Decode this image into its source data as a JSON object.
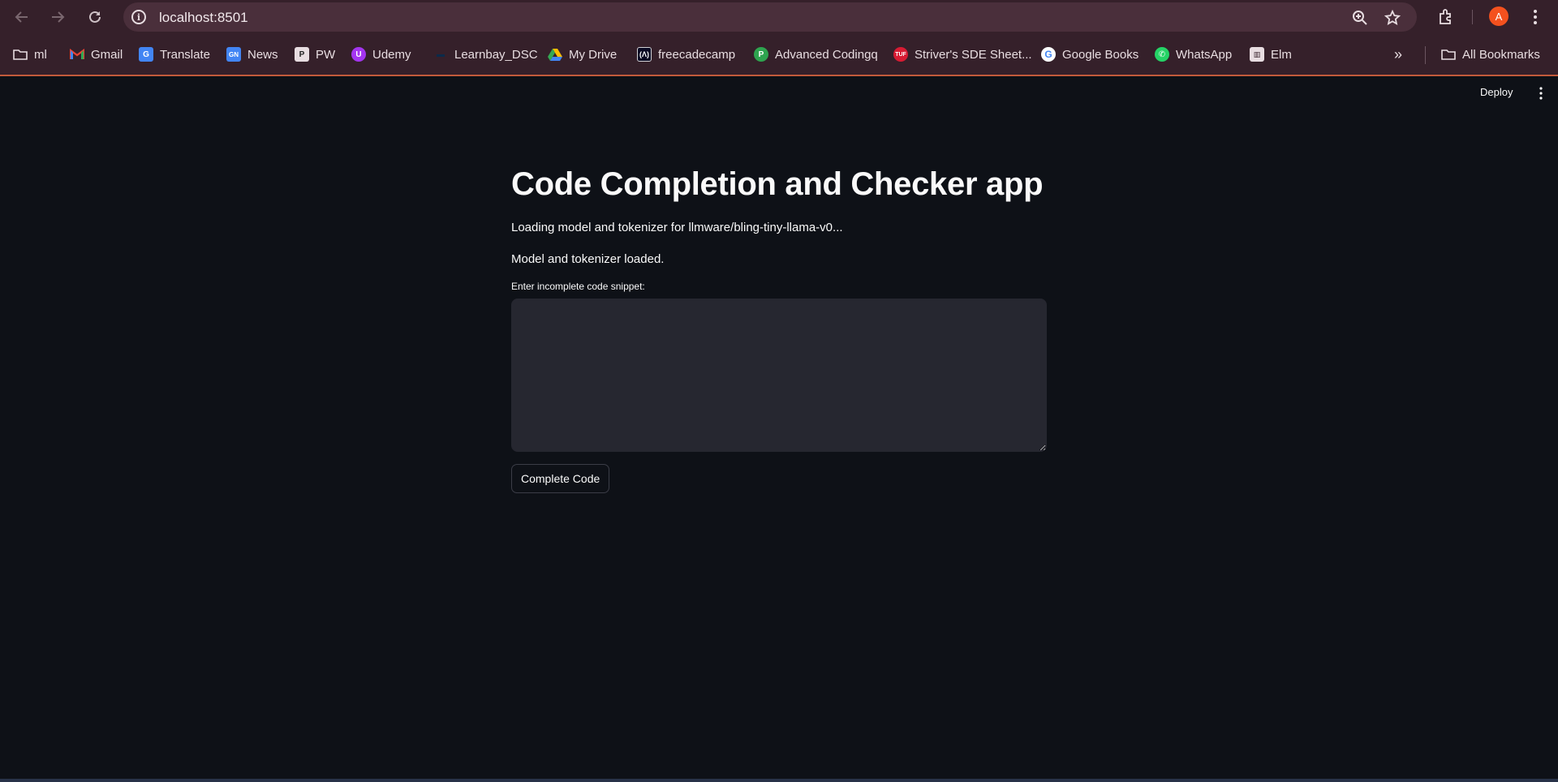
{
  "browser": {
    "url": "localhost:8501",
    "profile_initial": "A",
    "all_bookmarks_label": "All Bookmarks",
    "bookmarks": [
      {
        "label": "ml",
        "icon": "folder-icon",
        "color": "#e8dde1"
      },
      {
        "label": "Gmail",
        "icon": "gmail-icon",
        "color": "#ea4335"
      },
      {
        "label": "Translate",
        "icon": "translate-icon",
        "color": "#4285f4"
      },
      {
        "label": "News",
        "icon": "news-icon",
        "color": "#4285f4"
      },
      {
        "label": "PW",
        "icon": "pw-icon",
        "color": "#e8dde1"
      },
      {
        "label": "Udemy",
        "icon": "udemy-icon",
        "color": "#a435f0"
      },
      {
        "label": "Learnbay_DSC",
        "icon": "learnbay-icon",
        "color": "#0b2a4a"
      },
      {
        "label": "My Drive",
        "icon": "drive-icon",
        "color": "#34a853"
      },
      {
        "label": "freecadecamp",
        "icon": "freecodecamp-icon",
        "color": "#0a0a23"
      },
      {
        "label": "Advanced Codingq",
        "icon": "codingq-icon",
        "color": "#2ea44f"
      },
      {
        "label": "Striver's SDE Sheet...",
        "icon": "tuf-icon",
        "color": "#d81b33"
      },
      {
        "label": "Google Books",
        "icon": "google-icon",
        "color": "#ffffff"
      },
      {
        "label": "WhatsApp",
        "icon": "whatsapp-icon",
        "color": "#25d366"
      },
      {
        "label": "Elm",
        "icon": "elm-icon",
        "color": "#e8dde1"
      }
    ]
  },
  "app": {
    "deploy_label": "Deploy",
    "title": "Code Completion and Checker app",
    "loading_message": "Loading model and tokenizer for llmware/bling-tiny-llama-v0...",
    "loaded_message": "Model and tokenizer loaded.",
    "input_label": "Enter incomplete code snippet:",
    "input_value": "",
    "button_label": "Complete Code"
  }
}
